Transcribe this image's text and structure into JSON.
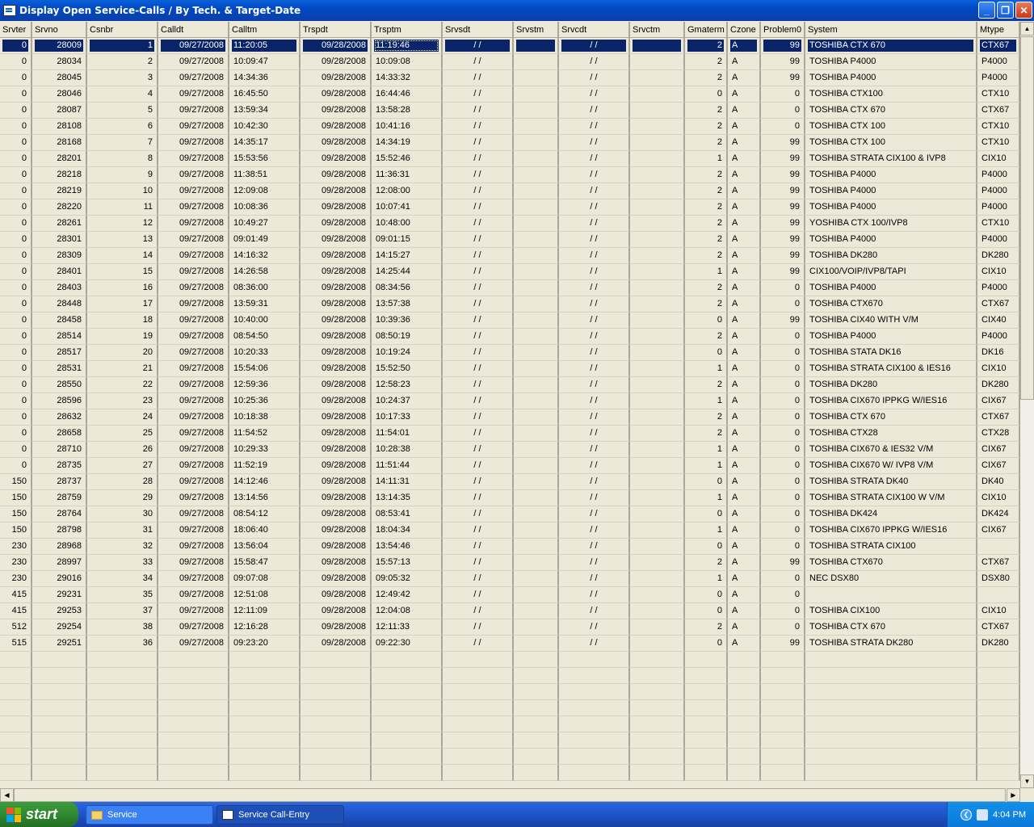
{
  "window": {
    "title": "Display Open Service-Calls / By Tech. & Target-Date"
  },
  "columns": [
    "Srvter",
    "Srvno",
    "Csnbr",
    "Calldt",
    "Calltm",
    "Trspdt",
    "Trsptm",
    "Srvsdt",
    "Srvstm",
    "Srvcdt",
    "Srvctm",
    "Gmaterm",
    "Czone",
    "Problem0",
    "System",
    "Mtype"
  ],
  "rows": [
    [
      "0",
      "28009",
      "1",
      "09/27/2008",
      "11:20:05",
      "09/28/2008",
      "11:19:46",
      "/ /",
      "",
      "/ /",
      "",
      "2",
      "A",
      "99",
      "TOSHIBA CTX 670",
      "CTX67"
    ],
    [
      "0",
      "28034",
      "2",
      "09/27/2008",
      "10:09:47",
      "09/28/2008",
      "10:09:08",
      "/ /",
      "",
      "/ /",
      "",
      "2",
      "A",
      "99",
      "TOSHIBA P4000",
      "P4000"
    ],
    [
      "0",
      "28045",
      "3",
      "09/27/2008",
      "14:34:36",
      "09/28/2008",
      "14:33:32",
      "/ /",
      "",
      "/ /",
      "",
      "2",
      "A",
      "99",
      "TOSHIBA P4000",
      "P4000"
    ],
    [
      "0",
      "28046",
      "4",
      "09/27/2008",
      "16:45:50",
      "09/28/2008",
      "16:44:46",
      "/ /",
      "",
      "/ /",
      "",
      "0",
      "A",
      "0",
      "TOSHIBA CTX100",
      "CTX10"
    ],
    [
      "0",
      "28087",
      "5",
      "09/27/2008",
      "13:59:34",
      "09/28/2008",
      "13:58:28",
      "/ /",
      "",
      "/ /",
      "",
      "2",
      "A",
      "0",
      "TOSHIBA CTX 670",
      "CTX67"
    ],
    [
      "0",
      "28108",
      "6",
      "09/27/2008",
      "10:42:30",
      "09/28/2008",
      "10:41:16",
      "/ /",
      "",
      "/ /",
      "",
      "2",
      "A",
      "0",
      "TOSHIBA CTX 100",
      "CTX10"
    ],
    [
      "0",
      "28168",
      "7",
      "09/27/2008",
      "14:35:17",
      "09/28/2008",
      "14:34:19",
      "/ /",
      "",
      "/ /",
      "",
      "2",
      "A",
      "99",
      "TOSHIBA CTX 100",
      "CTX10"
    ],
    [
      "0",
      "28201",
      "8",
      "09/27/2008",
      "15:53:56",
      "09/28/2008",
      "15:52:46",
      "/ /",
      "",
      "/ /",
      "",
      "1",
      "A",
      "99",
      "TOSHIBA STRATA CIX100 & IVP8",
      "CIX10"
    ],
    [
      "0",
      "28218",
      "9",
      "09/27/2008",
      "11:38:51",
      "09/28/2008",
      "11:36:31",
      "/ /",
      "",
      "/ /",
      "",
      "2",
      "A",
      "99",
      "TOSHIBA P4000",
      "P4000"
    ],
    [
      "0",
      "28219",
      "10",
      "09/27/2008",
      "12:09:08",
      "09/28/2008",
      "12:08:00",
      "/ /",
      "",
      "/ /",
      "",
      "2",
      "A",
      "99",
      "TOSHIBA P4000",
      "P4000"
    ],
    [
      "0",
      "28220",
      "11",
      "09/27/2008",
      "10:08:36",
      "09/28/2008",
      "10:07:41",
      "/ /",
      "",
      "/ /",
      "",
      "2",
      "A",
      "99",
      "TOSHIBA P4000",
      "P4000"
    ],
    [
      "0",
      "28261",
      "12",
      "09/27/2008",
      "10:49:27",
      "09/28/2008",
      "10:48:00",
      "/ /",
      "",
      "/ /",
      "",
      "2",
      "A",
      "99",
      "YOSHIBA CTX 100/IVP8",
      "CTX10"
    ],
    [
      "0",
      "28301",
      "13",
      "09/27/2008",
      "09:01:49",
      "09/28/2008",
      "09:01:15",
      "/ /",
      "",
      "/ /",
      "",
      "2",
      "A",
      "99",
      "TOSHIBA P4000",
      "P4000"
    ],
    [
      "0",
      "28309",
      "14",
      "09/27/2008",
      "14:16:32",
      "09/28/2008",
      "14:15:27",
      "/ /",
      "",
      "/ /",
      "",
      "2",
      "A",
      "99",
      "TOSHIBA DK280",
      "DK280"
    ],
    [
      "0",
      "28401",
      "15",
      "09/27/2008",
      "14:26:58",
      "09/28/2008",
      "14:25:44",
      "/ /",
      "",
      "/ /",
      "",
      "1",
      "A",
      "99",
      "CIX100/VOIP/IVP8/TAPI",
      "CIX10"
    ],
    [
      "0",
      "28403",
      "16",
      "09/27/2008",
      "08:36:00",
      "09/28/2008",
      "08:34:56",
      "/ /",
      "",
      "/ /",
      "",
      "2",
      "A",
      "0",
      "TOSHIBA P4000",
      "P4000"
    ],
    [
      "0",
      "28448",
      "17",
      "09/27/2008",
      "13:59:31",
      "09/28/2008",
      "13:57:38",
      "/ /",
      "",
      "/ /",
      "",
      "2",
      "A",
      "0",
      "TOSHIBA CTX670",
      "CTX67"
    ],
    [
      "0",
      "28458",
      "18",
      "09/27/2008",
      "10:40:00",
      "09/28/2008",
      "10:39:36",
      "/ /",
      "",
      "/ /",
      "",
      "0",
      "A",
      "99",
      "TOSHIBA CIX40 WITH V/M",
      "CIX40"
    ],
    [
      "0",
      "28514",
      "19",
      "09/27/2008",
      "08:54:50",
      "09/28/2008",
      "08:50:19",
      "/ /",
      "",
      "/ /",
      "",
      "2",
      "A",
      "0",
      "TOSHIBA P4000",
      "P4000"
    ],
    [
      "0",
      "28517",
      "20",
      "09/27/2008",
      "10:20:33",
      "09/28/2008",
      "10:19:24",
      "/ /",
      "",
      "/ /",
      "",
      "0",
      "A",
      "0",
      "TOSHIBA STATA DK16",
      "DK16"
    ],
    [
      "0",
      "28531",
      "21",
      "09/27/2008",
      "15:54:06",
      "09/28/2008",
      "15:52:50",
      "/ /",
      "",
      "/ /",
      "",
      "1",
      "A",
      "0",
      "TOSHIBA STRATA CIX100 & IES16",
      "CIX10"
    ],
    [
      "0",
      "28550",
      "22",
      "09/27/2008",
      "12:59:36",
      "09/28/2008",
      "12:58:23",
      "/ /",
      "",
      "/ /",
      "",
      "2",
      "A",
      "0",
      "TOSHIBA DK280",
      "DK280"
    ],
    [
      "0",
      "28596",
      "23",
      "09/27/2008",
      "10:25:36",
      "09/28/2008",
      "10:24:37",
      "/ /",
      "",
      "/ /",
      "",
      "1",
      "A",
      "0",
      "TOSHIBA CIX670 IPPKG W/IES16",
      "CIX67"
    ],
    [
      "0",
      "28632",
      "24",
      "09/27/2008",
      "10:18:38",
      "09/28/2008",
      "10:17:33",
      "/ /",
      "",
      "/ /",
      "",
      "2",
      "A",
      "0",
      "TOSHIBA CTX 670",
      "CTX67"
    ],
    [
      "0",
      "28658",
      "25",
      "09/27/2008",
      "11:54:52",
      "09/28/2008",
      "11:54:01",
      "/ /",
      "",
      "/ /",
      "",
      "2",
      "A",
      "0",
      "TOSHIBA CTX28",
      "CTX28"
    ],
    [
      "0",
      "28710",
      "26",
      "09/27/2008",
      "10:29:33",
      "09/28/2008",
      "10:28:38",
      "/ /",
      "",
      "/ /",
      "",
      "1",
      "A",
      "0",
      "TOSHIBA CIX670 & IES32 V/M",
      "CIX67"
    ],
    [
      "0",
      "28735",
      "27",
      "09/27/2008",
      "11:52:19",
      "09/28/2008",
      "11:51:44",
      "/ /",
      "",
      "/ /",
      "",
      "1",
      "A",
      "0",
      "TOSHIBA CIX670 W/ IVP8 V/M",
      "CIX67"
    ],
    [
      "150",
      "28737",
      "28",
      "09/27/2008",
      "14:12:46",
      "09/28/2008",
      "14:11:31",
      "/ /",
      "",
      "/ /",
      "",
      "0",
      "A",
      "0",
      "TOSHIBA STRATA DK40",
      "DK40"
    ],
    [
      "150",
      "28759",
      "29",
      "09/27/2008",
      "13:14:56",
      "09/28/2008",
      "13:14:35",
      "/ /",
      "",
      "/ /",
      "",
      "1",
      "A",
      "0",
      "TOSHIBA STRATA CIX100 W V/M",
      "CIX10"
    ],
    [
      "150",
      "28764",
      "30",
      "09/27/2008",
      "08:54:12",
      "09/28/2008",
      "08:53:41",
      "/ /",
      "",
      "/ /",
      "",
      "0",
      "A",
      "0",
      "TOSHIBA DK424",
      "DK424"
    ],
    [
      "150",
      "28798",
      "31",
      "09/27/2008",
      "18:06:40",
      "09/28/2008",
      "18:04:34",
      "/ /",
      "",
      "/ /",
      "",
      "1",
      "A",
      "0",
      "TOSHIBA CIX670 IPPKG W/IES16",
      "CIX67"
    ],
    [
      "230",
      "28968",
      "32",
      "09/27/2008",
      "13:56:04",
      "09/28/2008",
      "13:54:46",
      "/ /",
      "",
      "/ /",
      "",
      "0",
      "A",
      "0",
      "TOSHIBA STRATA CIX100",
      ""
    ],
    [
      "230",
      "28997",
      "33",
      "09/27/2008",
      "15:58:47",
      "09/28/2008",
      "15:57:13",
      "/ /",
      "",
      "/ /",
      "",
      "2",
      "A",
      "99",
      "TOSHIBA CTX670",
      "CTX67"
    ],
    [
      "230",
      "29016",
      "34",
      "09/27/2008",
      "09:07:08",
      "09/28/2008",
      "09:05:32",
      "/ /",
      "",
      "/ /",
      "",
      "1",
      "A",
      "0",
      "NEC DSX80",
      "DSX80"
    ],
    [
      "415",
      "29231",
      "35",
      "09/27/2008",
      "12:51:08",
      "09/28/2008",
      "12:49:42",
      "/ /",
      "",
      "/ /",
      "",
      "0",
      "A",
      "0",
      "",
      ""
    ],
    [
      "415",
      "29253",
      "37",
      "09/27/2008",
      "12:11:09",
      "09/28/2008",
      "12:04:08",
      "/ /",
      "",
      "/ /",
      "",
      "0",
      "A",
      "0",
      "TOSHIBA CIX100",
      "CIX10"
    ],
    [
      "512",
      "29254",
      "38",
      "09/27/2008",
      "12:16:28",
      "09/28/2008",
      "12:11:33",
      "/ /",
      "",
      "/ /",
      "",
      "2",
      "A",
      "0",
      "TOSHIBA CTX 670",
      "CTX67"
    ],
    [
      "515",
      "29251",
      "36",
      "09/27/2008",
      "09:23:20",
      "09/28/2008",
      "09:22:30",
      "/ /",
      "",
      "/ /",
      "",
      "0",
      "A",
      "99",
      "TOSHIBA STRATA DK280",
      "DK280"
    ]
  ],
  "empty_rows": 8,
  "selected_row": 0,
  "taskbar": {
    "start_label": "start",
    "tasks": [
      {
        "label": "Service",
        "icon": "folder-icon"
      },
      {
        "label": "Service Call-Entry",
        "icon": "app-icon"
      }
    ],
    "clock": "4:04 PM"
  },
  "colors": {
    "selection": "#0a246a",
    "title_bar": "#0049c4",
    "grid_bg": "#ece9d8",
    "start_green": "#2f8a2f"
  }
}
